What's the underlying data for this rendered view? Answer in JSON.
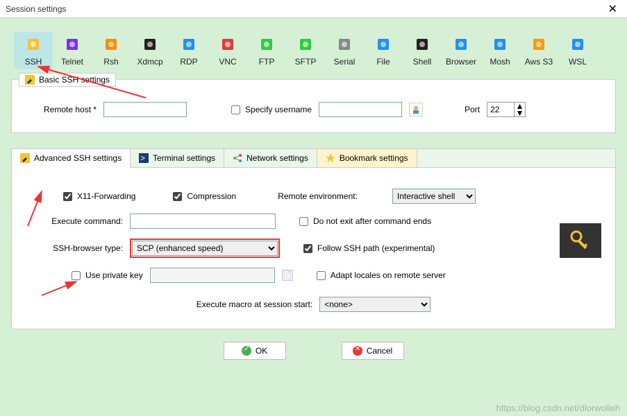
{
  "window": {
    "title": "Session settings"
  },
  "types": [
    {
      "key": "ssh",
      "label": "SSH",
      "color": "#f4c430",
      "selected": true
    },
    {
      "key": "telnet",
      "label": "Telnet",
      "color": "#7b2ff7"
    },
    {
      "key": "rsh",
      "label": "Rsh",
      "color": "#ff8c00"
    },
    {
      "key": "xdmcp",
      "label": "Xdmcp",
      "color": "#222"
    },
    {
      "key": "rdp",
      "label": "RDP",
      "color": "#1e90ff"
    },
    {
      "key": "vnc",
      "label": "VNC",
      "color": "#e03c3c"
    },
    {
      "key": "ftp",
      "label": "FTP",
      "color": "#2ecc40"
    },
    {
      "key": "sftp",
      "label": "SFTP",
      "color": "#2ecc40"
    },
    {
      "key": "serial",
      "label": "Serial",
      "color": "#888"
    },
    {
      "key": "file",
      "label": "File",
      "color": "#1e90ff"
    },
    {
      "key": "shell",
      "label": "Shell",
      "color": "#222"
    },
    {
      "key": "browser",
      "label": "Browser",
      "color": "#1e90ff"
    },
    {
      "key": "mosh",
      "label": "Mosh",
      "color": "#1e90ff"
    },
    {
      "key": "awss3",
      "label": "Aws S3",
      "color": "#ff9900"
    },
    {
      "key": "wsl",
      "label": "WSL",
      "color": "#1e90ff"
    }
  ],
  "basic": {
    "legend": "Basic SSH settings",
    "remote_host_label": "Remote host *",
    "remote_host_value": "",
    "specify_username_label": "Specify username",
    "specify_username_checked": false,
    "username_value": "",
    "port_label": "Port",
    "port_value": "22"
  },
  "tabs": {
    "advanced": "Advanced SSH settings",
    "terminal": "Terminal settings",
    "network": "Network settings",
    "bookmark": "Bookmark settings"
  },
  "adv": {
    "x11_label": "X11-Forwarding",
    "x11_checked": true,
    "compression_label": "Compression",
    "compression_checked": true,
    "remote_env_label": "Remote environment:",
    "remote_env_value": "Interactive shell",
    "exec_cmd_label": "Execute command:",
    "exec_cmd_value": "",
    "no_exit_label": "Do not exit after command ends",
    "no_exit_checked": false,
    "browser_type_label": "SSH-browser type:",
    "browser_type_value": "SCP (enhanced speed)",
    "follow_path_label": "Follow SSH path (experimental)",
    "follow_path_checked": true,
    "private_key_label": "Use private key",
    "private_key_checked": false,
    "private_key_value": "",
    "adapt_locales_label": "Adapt locales on remote server",
    "adapt_locales_checked": false,
    "exec_macro_label": "Execute macro at session start:",
    "exec_macro_value": "<none>"
  },
  "buttons": {
    "ok": "OK",
    "cancel": "Cancel"
  },
  "watermark": "https://blog.csdn.net/dlorwolleh"
}
